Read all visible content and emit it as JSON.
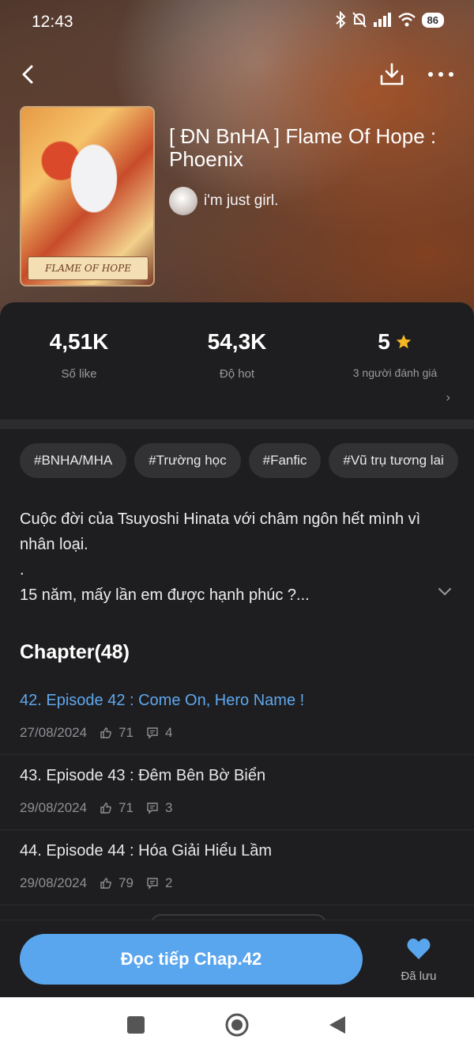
{
  "status_bar": {
    "time": "12:43",
    "battery": "86"
  },
  "book": {
    "title": "[ ĐN BnHA ] Flame Of Hope : Phoenix",
    "cover_text": "FLAME OF HOPE",
    "author": "i'm just girl."
  },
  "stats": {
    "likes_value": "4,51K",
    "likes_label": "Số like",
    "hot_value": "54,3K",
    "hot_label": "Độ hot",
    "rating_value": "5",
    "rating_label": "3 người đánh giá"
  },
  "tags": [
    "#BNHA/MHA",
    "#Trường học",
    "#Fanfic",
    "#Vũ trụ tương lai"
  ],
  "description": {
    "line1": "Cuộc đời của Tsuyoshi Hinata với châm ngôn hết mình vì nhân loại.",
    "line2": ".",
    "line3": "15 năm, mấy lần em được hạnh phúc ?..."
  },
  "chapters_header": "Chapter(48)",
  "chapters": [
    {
      "title": "42. Episode 42 : Come On, Hero Name !",
      "date": "27/08/2024",
      "likes": "71",
      "comments": "4"
    },
    {
      "title": "43. Episode 43 : Đêm Bên Bờ Biển",
      "date": "29/08/2024",
      "likes": "71",
      "comments": "3"
    },
    {
      "title": "44. Episode 44 : Hóa Giải Hiểu Lầm",
      "date": "29/08/2024",
      "likes": "79",
      "comments": "2"
    }
  ],
  "actions": {
    "read_label": "Đọc tiếp Chap.42",
    "saved_label": "Đã lưu"
  },
  "colors": {
    "accent": "#5aa6ee",
    "star": "#f5b623",
    "background": "#1e1e20"
  }
}
